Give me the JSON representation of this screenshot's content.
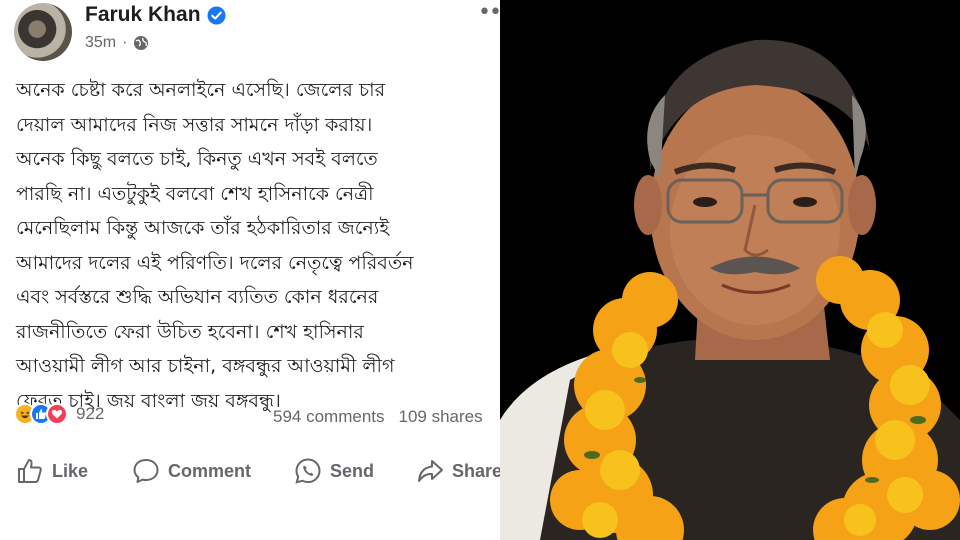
{
  "post": {
    "author": "Faruk Khan",
    "time": "35m",
    "lines": [
      "অনেক চেষ্টা করে অনলাইনে এসেছি। জেলের চার",
      "দেয়াল আমাদের নিজ সত্তার সামনে দাঁড়া করায়।",
      "অনেক কিছু বলতে চাই, কিনতু এখন সবই বলতে",
      "পারছি না। এতটুকুই বলবো শেখ হাসিনাকে নেত্রী",
      "মেনেছিলাম কিন্তু আজকে তাঁর হঠকারিতার জন্যেই",
      "আমাদের দলের এই পরিণতি। দলের নেতৃত্বে পরিবর্তন",
      "এবং সর্বস্তরে শুদ্ধি অভিযান ব্যতিত কোন ধরনের",
      "রাজনীতিতে ফেরা উচিত হবেনা। শেখ হাসিনার",
      "আওয়ামী লীগ আর চাইনা, বঙ্গবন্ধুর আওয়ামী লীগ",
      "ফেরত চাই। জয় বাংলা জয় বঙ্গবন্ধু।"
    ],
    "reaction_count": "922",
    "comments": "594 comments",
    "shares": "109 shares",
    "reaction_icons": [
      "haha-emoji",
      "like-emoji",
      "love-emoji"
    ]
  },
  "actions": {
    "like": "Like",
    "comment": "Comment",
    "send": "Send",
    "share": "Share"
  },
  "colors": {
    "facebook_blue": "#1877f2",
    "muted_text": "#65676b",
    "body_text": "#1c1e21",
    "photo_background": "#000000",
    "garland": "#f59a16"
  }
}
